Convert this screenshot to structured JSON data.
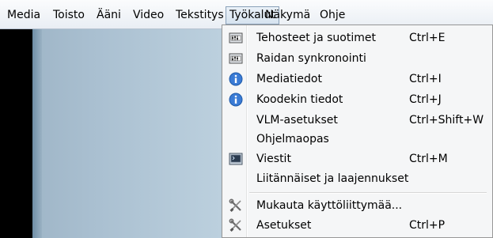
{
  "menubar": {
    "items": [
      {
        "label": "Media"
      },
      {
        "label": "Toisto"
      },
      {
        "label": "Ääni"
      },
      {
        "label": "Video"
      },
      {
        "label": "Tekstitys"
      },
      {
        "label": "Työkalut"
      },
      {
        "label": "Näkymä"
      },
      {
        "label": "Ohje"
      }
    ],
    "active_index": 5
  },
  "dropdown": {
    "items": [
      {
        "label": "Tehosteet ja suotimet",
        "shortcut": "Ctrl+E",
        "icon": "equalizer-icon"
      },
      {
        "label": "Raidan synkronointi",
        "shortcut": "",
        "icon": "equalizer-icon"
      },
      {
        "label": "Mediatiedot",
        "shortcut": "Ctrl+I",
        "icon": "info-icon"
      },
      {
        "label": "Koodekin tiedot",
        "shortcut": "Ctrl+J",
        "icon": "info-icon"
      },
      {
        "label": "VLM-asetukset",
        "shortcut": "Ctrl+Shift+W",
        "icon": ""
      },
      {
        "label": "Ohjelmaopas",
        "shortcut": "",
        "icon": ""
      },
      {
        "label": "Viestit",
        "shortcut": "Ctrl+M",
        "icon": "terminal-icon"
      },
      {
        "label": "Liitännäiset ja laajennukset",
        "shortcut": "",
        "icon": ""
      },
      {
        "label": "Mukauta käyttöliittymää...",
        "shortcut": "",
        "icon": "wrench-screwdriver-icon"
      },
      {
        "label": "Asetukset",
        "shortcut": "Ctrl+P",
        "icon": "wrench-screwdriver-icon"
      }
    ]
  },
  "colors": {
    "info_icon": "#3a7bd5",
    "video_bg": "#bcd0de"
  }
}
